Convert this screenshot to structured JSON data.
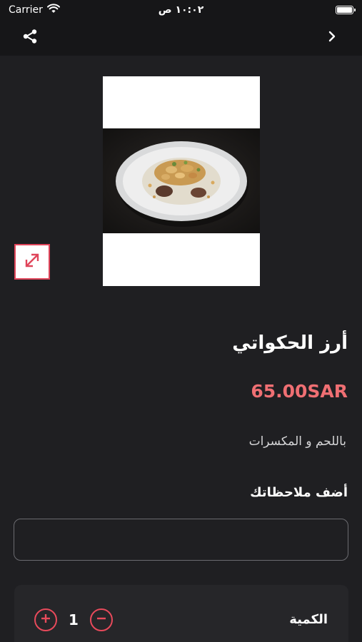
{
  "status_bar": {
    "carrier": "Carrier",
    "time": "١٠:٠٢ ص",
    "icons": [
      "wifi-icon",
      "battery-icon"
    ]
  },
  "nav": {
    "icons": [
      "share-icon",
      "chevron-right-icon"
    ]
  },
  "product": {
    "name": "أرز الحكواتي",
    "price": "65.00SAR",
    "description": "باللحم و المكسرات",
    "expand_icon": "expand-arrows-icon"
  },
  "notes": {
    "label": "أضف ملاحظاتك",
    "value": "",
    "placeholder": ""
  },
  "quantity": {
    "label": "الكمية",
    "value": "1",
    "icons": [
      "plus-circle-icon",
      "minus-circle-icon"
    ]
  },
  "colors": {
    "background": "#1f1f22",
    "bar": "#161618",
    "accent": "#e84a5b",
    "price": "#ef6f73",
    "card": "#262629"
  }
}
